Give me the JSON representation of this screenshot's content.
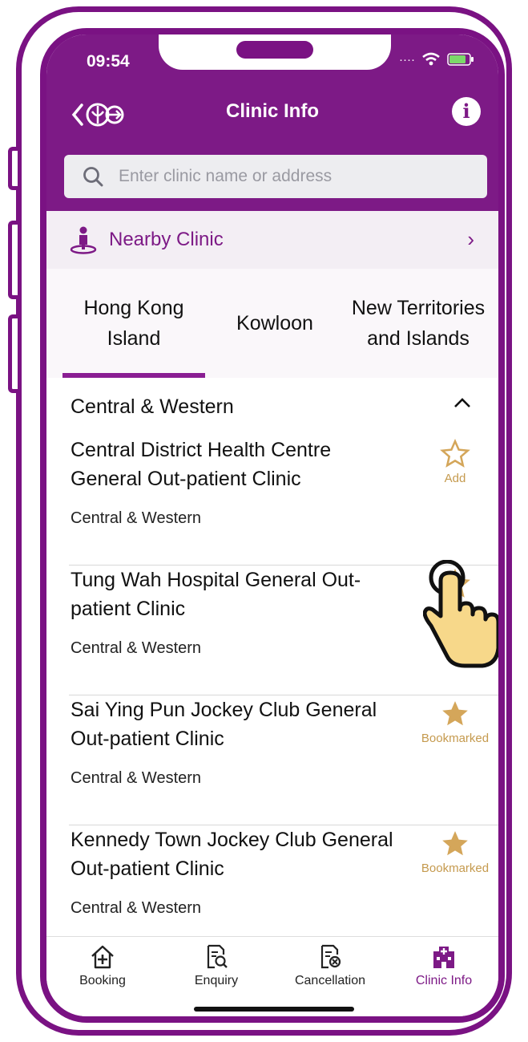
{
  "status": {
    "time": "09:54"
  },
  "header": {
    "title": "Clinic Info",
    "info_label": "i",
    "search_placeholder": "Enter clinic name or address"
  },
  "nearby": {
    "label": "Nearby Clinic",
    "chevron": "›"
  },
  "tabs": [
    {
      "label": "Hong Kong Island",
      "active": true
    },
    {
      "label": "Kowloon",
      "active": false
    },
    {
      "label": "New Territories and Islands",
      "active": false
    }
  ],
  "district": {
    "name": "Central & Western",
    "chevron": "^"
  },
  "clinics": [
    {
      "name": "Central District Health Centre General Out-patient Clinic",
      "area": "Central & Western",
      "bookmark_label": "Add",
      "bookmarked": false
    },
    {
      "name": "Tung Wah Hospital General Out-patient Clinic",
      "area": "Central & Western",
      "bookmark_label": "",
      "bookmarked": false
    },
    {
      "name": "Sai Ying Pun Jockey Club General Out-patient Clinic",
      "area": "Central & Western",
      "bookmark_label": "Bookmarked",
      "bookmarked": true
    },
    {
      "name": "Kennedy Town Jockey Club General Out-patient Clinic",
      "area": "Central & Western",
      "bookmark_label": "Bookmarked",
      "bookmarked": true
    }
  ],
  "tabbar": {
    "items": [
      {
        "label": "Booking",
        "icon": "house-plus-icon"
      },
      {
        "label": "Enquiry",
        "icon": "document-search-icon"
      },
      {
        "label": "Cancellation",
        "icon": "document-cancel-icon"
      },
      {
        "label": "Clinic Info",
        "icon": "clinic-building-icon",
        "active": true
      }
    ]
  },
  "colors": {
    "brand": "#7d1a86",
    "frame": "#7a1283",
    "star": "#d4a65a",
    "star_label": "#c59a4e",
    "hand": "#f7d88a"
  }
}
